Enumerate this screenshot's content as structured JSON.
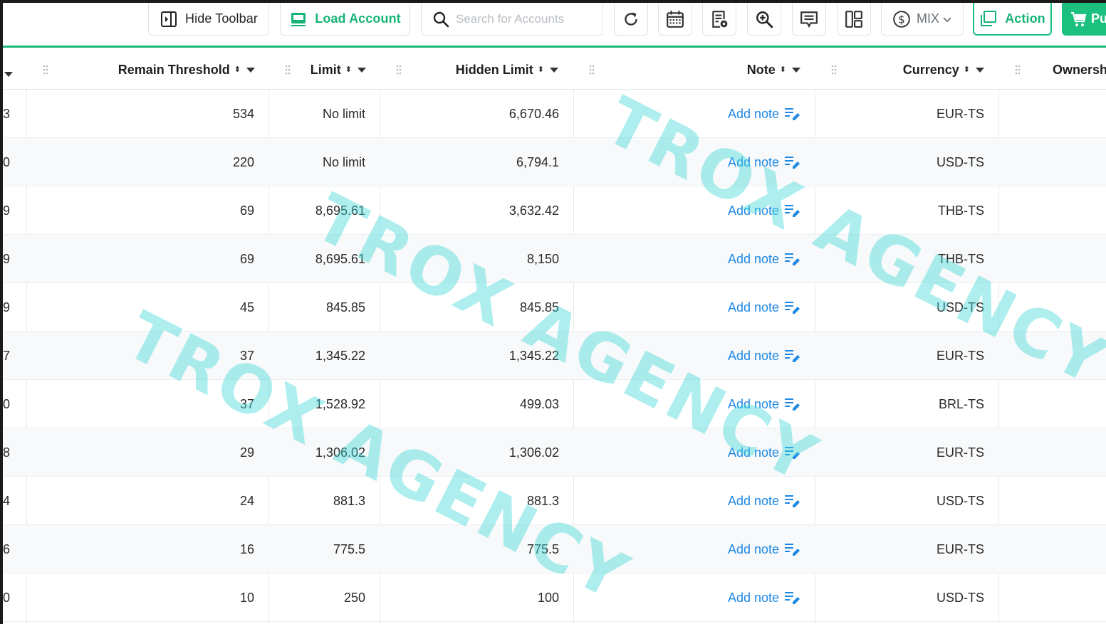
{
  "toolbar": {
    "hide_toolbar_label": "Hide Toolbar",
    "load_account_label": "Load Account",
    "search_placeholder": "Search for Accounts",
    "currency_mode": "MIX",
    "action_label": "Action",
    "purchase_label_partial": "Pu",
    "icons": [
      "sidebar-toggle-icon",
      "load-account-icon",
      "search-icon",
      "refresh-icon",
      "calendar-icon",
      "report-settings-icon",
      "zoom-in-icon",
      "message-icon",
      "layout-icon",
      "dollar-icon",
      "chevron-down-icon",
      "action-window-icon",
      "cart-icon"
    ]
  },
  "colors": {
    "accent_green": "#1bc07f",
    "link_blue": "#1e88e5",
    "watermark": "#3fd8d8"
  },
  "table": {
    "headers": {
      "remain_threshold": "Remain Threshold",
      "limit": "Limit",
      "hidden_limit": "Hidden Limit",
      "note": "Note",
      "currency": "Currency",
      "ownership_partial": "Ownersh"
    },
    "rows": [
      {
        "prev": "3",
        "remain": "534",
        "limit": "No limit",
        "hidden": "6,670.46",
        "note": "Add note",
        "currency": "EUR-TS"
      },
      {
        "prev": "0",
        "remain": "220",
        "limit": "No limit",
        "hidden": "6,794.1",
        "note": "Add note",
        "currency": "USD-TS"
      },
      {
        "prev": "9",
        "remain": "69",
        "limit": "8,695.61",
        "hidden": "3,632.42",
        "note": "Add note",
        "currency": "THB-TS"
      },
      {
        "prev": "9",
        "remain": "69",
        "limit": "8,695.61",
        "hidden": "8,150",
        "note": "Add note",
        "currency": "THB-TS"
      },
      {
        "prev": "9",
        "remain": "45",
        "limit": "845.85",
        "hidden": "845.85",
        "note": "Add note",
        "currency": "USD-TS"
      },
      {
        "prev": "7",
        "remain": "37",
        "limit": "1,345.22",
        "hidden": "1,345.22",
        "note": "Add note",
        "currency": "EUR-TS"
      },
      {
        "prev": "0",
        "remain": "37",
        "limit": "1,528.92",
        "hidden": "499.03",
        "note": "Add note",
        "currency": "BRL-TS"
      },
      {
        "prev": "8",
        "remain": "29",
        "limit": "1,306.02",
        "hidden": "1,306.02",
        "note": "Add note",
        "currency": "EUR-TS"
      },
      {
        "prev": "4",
        "remain": "24",
        "limit": "881.3",
        "hidden": "881.3",
        "note": "Add note",
        "currency": "USD-TS"
      },
      {
        "prev": "6",
        "remain": "16",
        "limit": "775.5",
        "hidden": "775.5",
        "note": "Add note",
        "currency": "EUR-TS"
      },
      {
        "prev": "0",
        "remain": "10",
        "limit": "250",
        "hidden": "100",
        "note": "Add note",
        "currency": "USD-TS"
      }
    ]
  },
  "watermark": {
    "text": "TROX AGENCY"
  }
}
